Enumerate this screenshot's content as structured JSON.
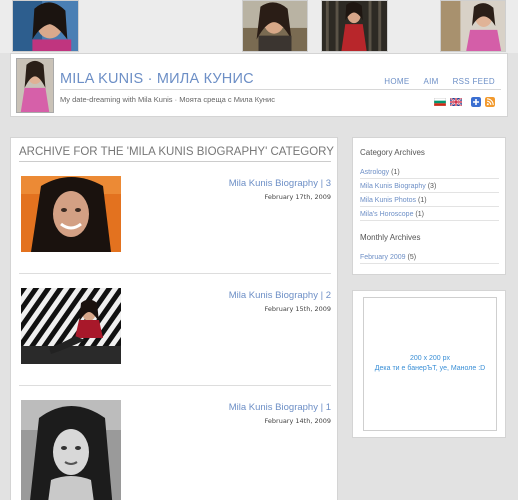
{
  "header": {
    "title": "MILA KUNIS · МИЛА КУНИС",
    "tagline": "My date-dreaming with Mila Kunis  ·  Моята среща с Мила Кунис",
    "nav": [
      "HOME",
      "AIM",
      "RSS FEED"
    ]
  },
  "main": {
    "heading": "ARCHIVE FOR THE 'MILA KUNIS BIOGRAPHY' CATEGORY",
    "posts": [
      {
        "title": "Mila Kunis Biography | 3",
        "date": "February 17th, 2009"
      },
      {
        "title": "Mila Kunis Biography | 2",
        "date": "February 15th, 2009"
      },
      {
        "title": "Mila Kunis Biography | 1",
        "date": "February 14th, 2009"
      }
    ]
  },
  "sidebar": {
    "category_heading": "Category Archives",
    "categories": [
      {
        "label": "Astrology",
        "count": "(1)"
      },
      {
        "label": "Mila Kunis Biography",
        "count": "(3)"
      },
      {
        "label": "Mila Kunis Photos",
        "count": "(1)"
      },
      {
        "label": "Mila's Horoscope",
        "count": "(1)"
      }
    ],
    "monthly_heading": "Monthly Archives",
    "months": [
      {
        "label": "February 2009",
        "count": "(5)"
      }
    ]
  },
  "banner": {
    "size": "200 x 200 px",
    "text": "Дека ти е банерЪТ, уе, Маноле :D"
  },
  "colors": {
    "accent": "#6d8fc6",
    "banner_text": "#3a8fd6",
    "background": "#e2e2e2"
  },
  "icons": [
    "bulgarian-flag-icon",
    "uk-flag-icon",
    "share-plus-icon",
    "rss-icon"
  ]
}
